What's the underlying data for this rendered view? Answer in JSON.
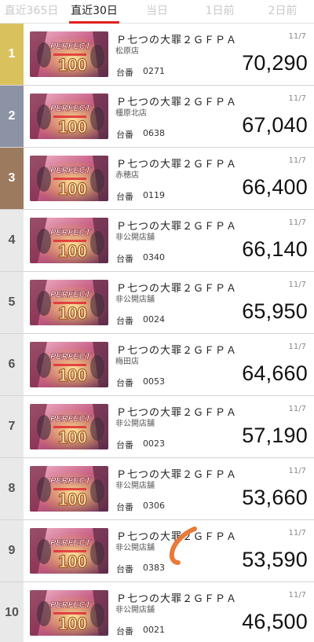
{
  "tabs": [
    {
      "label": "直近365日",
      "active": false
    },
    {
      "label": "直近30日",
      "active": true
    },
    {
      "label": "当日",
      "active": false
    },
    {
      "label": "1日前",
      "active": false
    },
    {
      "label": "2日前",
      "active": false
    }
  ],
  "colors": {
    "accent": "#e02020",
    "rank_gold": "#d9c25e",
    "rank_silver": "#8c93a5",
    "rank_bronze": "#9c7a5e",
    "rank_default": "#e9e9e9",
    "scribble": "#e87a3a"
  },
  "machine_label": "台番",
  "rows": [
    {
      "rank": "1",
      "name": "Ｐ七つの大罪２ＧＦＰＡ",
      "store": "松原店",
      "machine": "0271",
      "date": "11/7",
      "value": "70,290"
    },
    {
      "rank": "2",
      "name": "Ｐ七つの大罪２ＧＦＰＡ",
      "store": "橿原北店",
      "machine": "0638",
      "date": "11/7",
      "value": "67,040"
    },
    {
      "rank": "3",
      "name": "Ｐ七つの大罪２ＧＦＰＡ",
      "store": "赤穂店",
      "machine": "0119",
      "date": "11/7",
      "value": "66,400"
    },
    {
      "rank": "4",
      "name": "Ｐ七つの大罪２ＧＦＰＡ",
      "store": "非公開店舗",
      "machine": "0340",
      "date": "11/7",
      "value": "66,140"
    },
    {
      "rank": "5",
      "name": "Ｐ七つの大罪２ＧＦＰＡ",
      "store": "非公開店舗",
      "machine": "0024",
      "date": "11/7",
      "value": "65,950"
    },
    {
      "rank": "6",
      "name": "Ｐ七つの大罪２ＧＦＰＡ",
      "store": "梅田店",
      "machine": "0053",
      "date": "11/7",
      "value": "64,660"
    },
    {
      "rank": "7",
      "name": "Ｐ七つの大罪２ＧＦＰＡ",
      "store": "非公開店舗",
      "machine": "0023",
      "date": "11/7",
      "value": "57,190"
    },
    {
      "rank": "8",
      "name": "Ｐ七つの大罪２ＧＦＰＡ",
      "store": "非公開店舗",
      "machine": "0306",
      "date": "11/7",
      "value": "53,660"
    },
    {
      "rank": "9",
      "name": "Ｐ七つの大罪２ＧＦＰＡ",
      "store": "非公開店舗",
      "machine": "0383",
      "date": "11/7",
      "value": "53,590"
    },
    {
      "rank": "10",
      "name": "Ｐ七つの大罪２ＧＦＰＡ",
      "store": "非公開店舗",
      "machine": "0021",
      "date": "11/7",
      "value": "46,500"
    }
  ]
}
